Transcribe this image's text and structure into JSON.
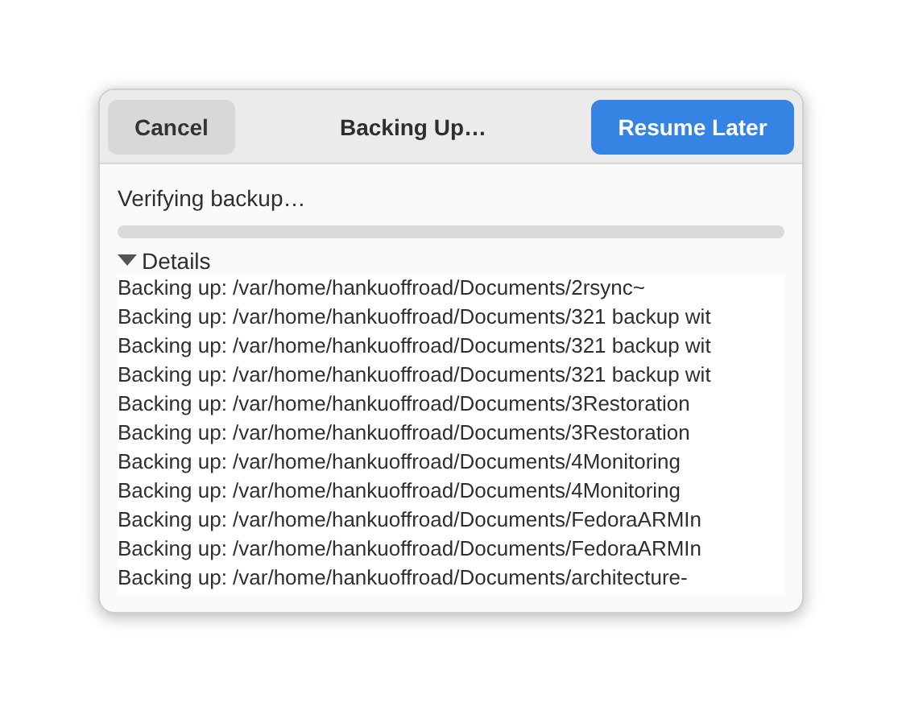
{
  "header": {
    "title": "Backing Up…",
    "cancel_button": "Cancel",
    "resume_button": "Resume Later"
  },
  "status": "Verifying backup…",
  "progress": {
    "level": 0
  },
  "details": {
    "label": "Details",
    "expanded": true,
    "lines": [
      "Backing up: /var/home/hankuoffroad/Documents/2rsync~",
      "Backing up: /var/home/hankuoffroad/Documents/321 backup wit",
      "Backing up: /var/home/hankuoffroad/Documents/321 backup wit",
      "Backing up: /var/home/hankuoffroad/Documents/321 backup wit",
      "Backing up: /var/home/hankuoffroad/Documents/3Restoration",
      "Backing up: /var/home/hankuoffroad/Documents/3Restoration",
      "Backing up: /var/home/hankuoffroad/Documents/4Monitoring",
      "Backing up: /var/home/hankuoffroad/Documents/4Monitoring",
      "Backing up: /var/home/hankuoffroad/Documents/FedoraARMIn",
      "Backing up: /var/home/hankuoffroad/Documents/FedoraARMIn",
      "Backing up: /var/home/hankuoffroad/Documents/architecture-"
    ]
  }
}
